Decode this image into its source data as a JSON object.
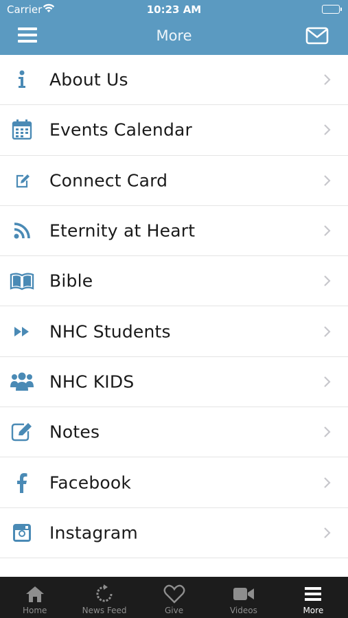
{
  "status_bar": {
    "carrier": "Carrier",
    "time": "10:23 AM"
  },
  "header": {
    "title": "More"
  },
  "menu": {
    "items": [
      {
        "label": "About Us",
        "icon": "info-icon"
      },
      {
        "label": "Events Calendar",
        "icon": "calendar-icon"
      },
      {
        "label": "Connect Card",
        "icon": "edit-icon"
      },
      {
        "label": "Eternity at Heart",
        "icon": "rss-icon"
      },
      {
        "label": "Bible",
        "icon": "book-icon"
      },
      {
        "label": "NHC Students",
        "icon": "fast-forward-icon"
      },
      {
        "label": "NHC KIDS",
        "icon": "users-icon"
      },
      {
        "label": "Notes",
        "icon": "notes-icon"
      },
      {
        "label": "Facebook",
        "icon": "facebook-icon"
      },
      {
        "label": "Instagram",
        "icon": "instagram-icon"
      }
    ]
  },
  "tabbar": {
    "tabs": [
      {
        "label": "Home",
        "icon": "home-icon"
      },
      {
        "label": "News Feed",
        "icon": "refresh-icon"
      },
      {
        "label": "Give",
        "icon": "heart-icon"
      },
      {
        "label": "Videos",
        "icon": "video-camera-icon"
      },
      {
        "label": "More",
        "icon": "menu-icon",
        "active": true
      }
    ]
  },
  "colors": {
    "header_bg": "#5b9ac1",
    "icon_accent": "#4a8ab5",
    "tabbar_bg": "#1c1c1c",
    "tab_inactive": "#8e8e8e",
    "tab_active": "#ffffff"
  }
}
